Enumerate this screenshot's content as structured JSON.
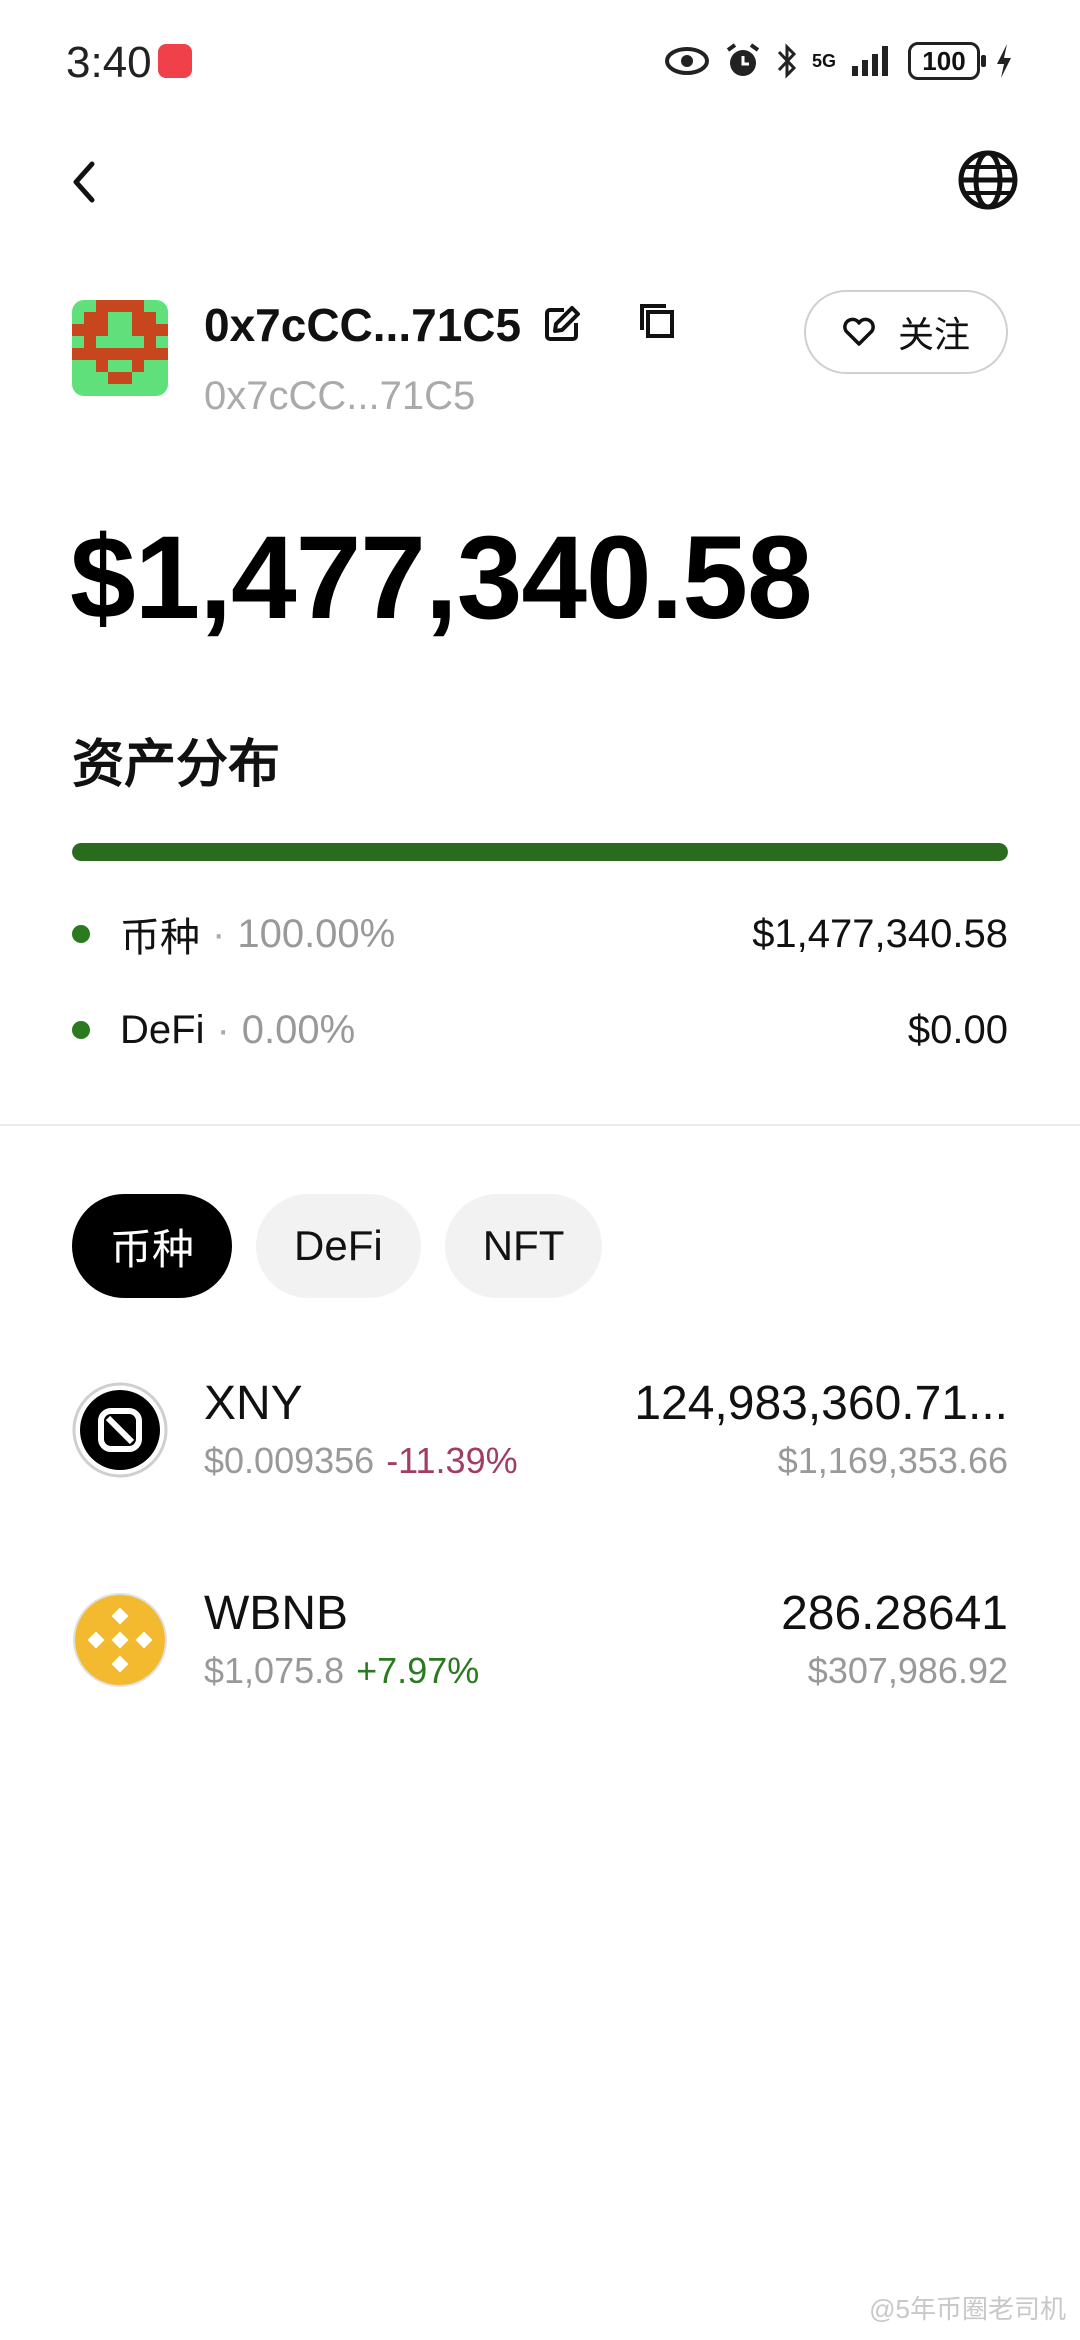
{
  "status_bar": {
    "time": "3:40",
    "network": "5G",
    "battery": "100"
  },
  "wallet": {
    "name": "0x7cCC...71C5",
    "address": "0x7cCC...71C5",
    "follow_label": "关注",
    "total_value": "$1,477,340.58"
  },
  "distribution": {
    "title": "资产分布",
    "bar_fraction": 1.0,
    "accent_color": "#2a6b1f",
    "rows": [
      {
        "label": "币种",
        "percent": "100.00%",
        "value": "$1,477,340.58"
      },
      {
        "label": "DeFi",
        "percent": "0.00%",
        "value": "$0.00"
      }
    ]
  },
  "tabs": [
    {
      "label": "币种",
      "active": true
    },
    {
      "label": "DeFi",
      "active": false
    },
    {
      "label": "NFT",
      "active": false
    }
  ],
  "tokens": [
    {
      "symbol": "XNY",
      "icon": "xny-logo-icon",
      "price": "$0.009356",
      "change": "-11.39%",
      "change_color": "#a13d63",
      "amount": "124,983,360.71...",
      "value": "$1,169,353.66"
    },
    {
      "symbol": "WBNB",
      "icon": "bnb-logo-icon",
      "price": "$1,075.8",
      "change": "+7.97%",
      "change_color": "#2a7a1f",
      "amount": "286.28641",
      "value": "$307,986.92"
    }
  ],
  "watermark": "@5年币圈老司机"
}
